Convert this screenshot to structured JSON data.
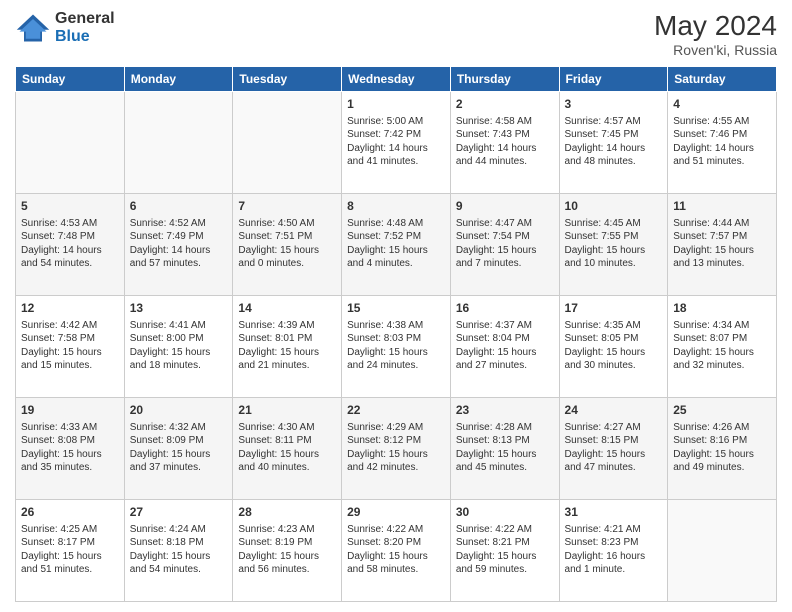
{
  "header": {
    "logo_general": "General",
    "logo_blue": "Blue",
    "month_year": "May 2024",
    "location": "Roven'ki, Russia"
  },
  "days_of_week": [
    "Sunday",
    "Monday",
    "Tuesday",
    "Wednesday",
    "Thursday",
    "Friday",
    "Saturday"
  ],
  "weeks": [
    [
      {
        "num": "",
        "info": ""
      },
      {
        "num": "",
        "info": ""
      },
      {
        "num": "",
        "info": ""
      },
      {
        "num": "1",
        "info": "Sunrise: 5:00 AM\nSunset: 7:42 PM\nDaylight: 14 hours\nand 41 minutes."
      },
      {
        "num": "2",
        "info": "Sunrise: 4:58 AM\nSunset: 7:43 PM\nDaylight: 14 hours\nand 44 minutes."
      },
      {
        "num": "3",
        "info": "Sunrise: 4:57 AM\nSunset: 7:45 PM\nDaylight: 14 hours\nand 48 minutes."
      },
      {
        "num": "4",
        "info": "Sunrise: 4:55 AM\nSunset: 7:46 PM\nDaylight: 14 hours\nand 51 minutes."
      }
    ],
    [
      {
        "num": "5",
        "info": "Sunrise: 4:53 AM\nSunset: 7:48 PM\nDaylight: 14 hours\nand 54 minutes."
      },
      {
        "num": "6",
        "info": "Sunrise: 4:52 AM\nSunset: 7:49 PM\nDaylight: 14 hours\nand 57 minutes."
      },
      {
        "num": "7",
        "info": "Sunrise: 4:50 AM\nSunset: 7:51 PM\nDaylight: 15 hours\nand 0 minutes."
      },
      {
        "num": "8",
        "info": "Sunrise: 4:48 AM\nSunset: 7:52 PM\nDaylight: 15 hours\nand 4 minutes."
      },
      {
        "num": "9",
        "info": "Sunrise: 4:47 AM\nSunset: 7:54 PM\nDaylight: 15 hours\nand 7 minutes."
      },
      {
        "num": "10",
        "info": "Sunrise: 4:45 AM\nSunset: 7:55 PM\nDaylight: 15 hours\nand 10 minutes."
      },
      {
        "num": "11",
        "info": "Sunrise: 4:44 AM\nSunset: 7:57 PM\nDaylight: 15 hours\nand 13 minutes."
      }
    ],
    [
      {
        "num": "12",
        "info": "Sunrise: 4:42 AM\nSunset: 7:58 PM\nDaylight: 15 hours\nand 15 minutes."
      },
      {
        "num": "13",
        "info": "Sunrise: 4:41 AM\nSunset: 8:00 PM\nDaylight: 15 hours\nand 18 minutes."
      },
      {
        "num": "14",
        "info": "Sunrise: 4:39 AM\nSunset: 8:01 PM\nDaylight: 15 hours\nand 21 minutes."
      },
      {
        "num": "15",
        "info": "Sunrise: 4:38 AM\nSunset: 8:03 PM\nDaylight: 15 hours\nand 24 minutes."
      },
      {
        "num": "16",
        "info": "Sunrise: 4:37 AM\nSunset: 8:04 PM\nDaylight: 15 hours\nand 27 minutes."
      },
      {
        "num": "17",
        "info": "Sunrise: 4:35 AM\nSunset: 8:05 PM\nDaylight: 15 hours\nand 30 minutes."
      },
      {
        "num": "18",
        "info": "Sunrise: 4:34 AM\nSunset: 8:07 PM\nDaylight: 15 hours\nand 32 minutes."
      }
    ],
    [
      {
        "num": "19",
        "info": "Sunrise: 4:33 AM\nSunset: 8:08 PM\nDaylight: 15 hours\nand 35 minutes."
      },
      {
        "num": "20",
        "info": "Sunrise: 4:32 AM\nSunset: 8:09 PM\nDaylight: 15 hours\nand 37 minutes."
      },
      {
        "num": "21",
        "info": "Sunrise: 4:30 AM\nSunset: 8:11 PM\nDaylight: 15 hours\nand 40 minutes."
      },
      {
        "num": "22",
        "info": "Sunrise: 4:29 AM\nSunset: 8:12 PM\nDaylight: 15 hours\nand 42 minutes."
      },
      {
        "num": "23",
        "info": "Sunrise: 4:28 AM\nSunset: 8:13 PM\nDaylight: 15 hours\nand 45 minutes."
      },
      {
        "num": "24",
        "info": "Sunrise: 4:27 AM\nSunset: 8:15 PM\nDaylight: 15 hours\nand 47 minutes."
      },
      {
        "num": "25",
        "info": "Sunrise: 4:26 AM\nSunset: 8:16 PM\nDaylight: 15 hours\nand 49 minutes."
      }
    ],
    [
      {
        "num": "26",
        "info": "Sunrise: 4:25 AM\nSunset: 8:17 PM\nDaylight: 15 hours\nand 51 minutes."
      },
      {
        "num": "27",
        "info": "Sunrise: 4:24 AM\nSunset: 8:18 PM\nDaylight: 15 hours\nand 54 minutes."
      },
      {
        "num": "28",
        "info": "Sunrise: 4:23 AM\nSunset: 8:19 PM\nDaylight: 15 hours\nand 56 minutes."
      },
      {
        "num": "29",
        "info": "Sunrise: 4:22 AM\nSunset: 8:20 PM\nDaylight: 15 hours\nand 58 minutes."
      },
      {
        "num": "30",
        "info": "Sunrise: 4:22 AM\nSunset: 8:21 PM\nDaylight: 15 hours\nand 59 minutes."
      },
      {
        "num": "31",
        "info": "Sunrise: 4:21 AM\nSunset: 8:23 PM\nDaylight: 16 hours\nand 1 minute."
      },
      {
        "num": "",
        "info": ""
      }
    ]
  ]
}
